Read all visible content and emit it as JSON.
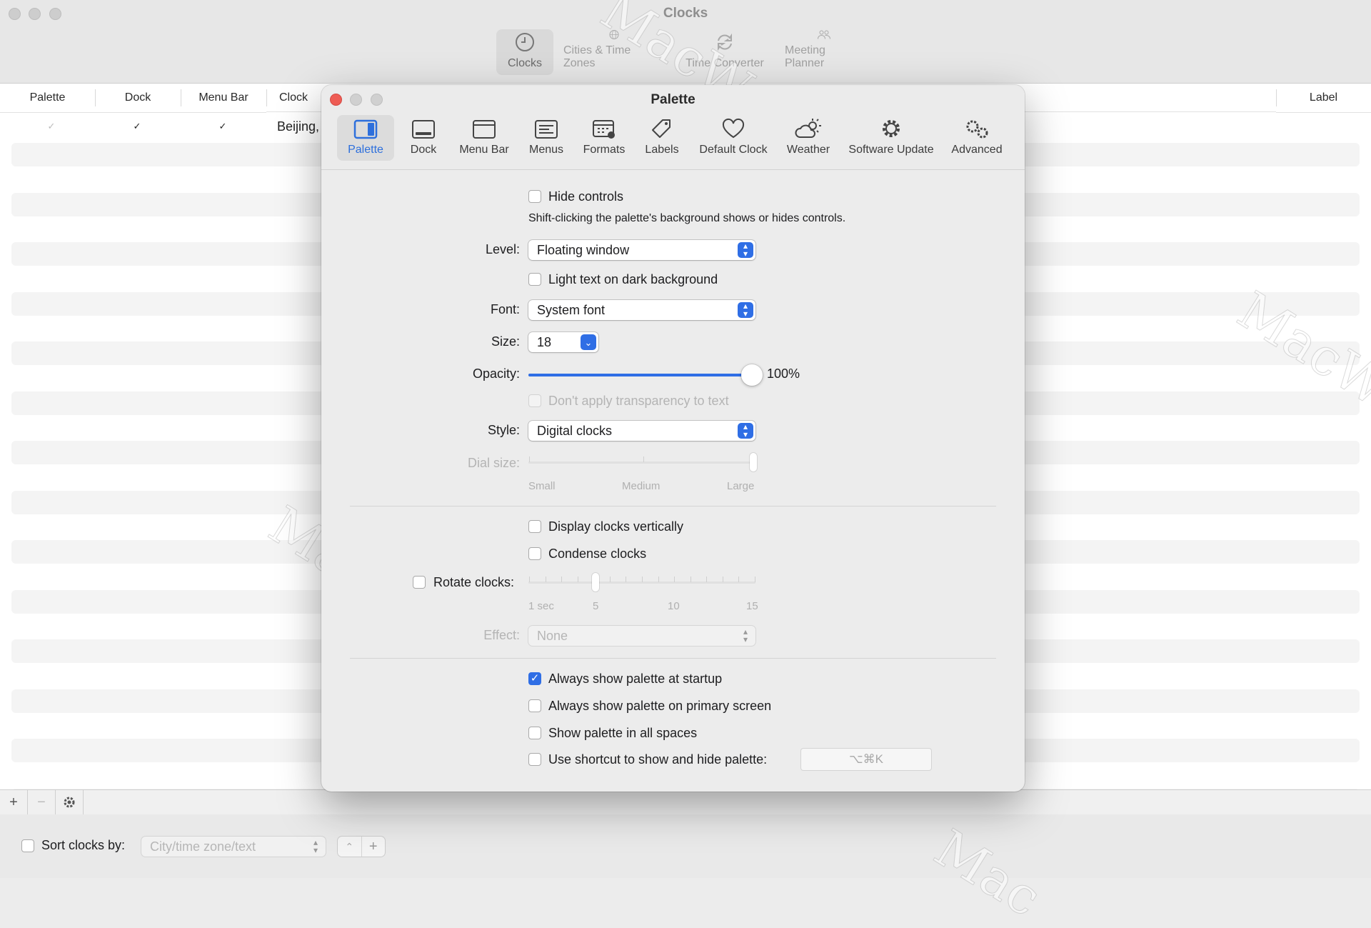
{
  "window": {
    "title": "Clocks",
    "tabs": [
      {
        "label": "Clocks",
        "icon": "clock-icon"
      },
      {
        "label": "Cities & Time Zones",
        "icon": "globe-icon"
      },
      {
        "label": "Time Converter",
        "icon": "sync-icon"
      },
      {
        "label": "Meeting Planner",
        "icon": "people-icon"
      }
    ]
  },
  "list": {
    "columns": [
      "Palette",
      "Dock",
      "Menu Bar",
      "Clock",
      "Label"
    ],
    "rows": [
      {
        "palette": true,
        "dock": true,
        "menubar": true,
        "clock": "Beijing,"
      }
    ]
  },
  "footer": {
    "sort_label": "Sort clocks by:",
    "sort_value": "City/time zone/text"
  },
  "dialog": {
    "title": "Palette",
    "tabs": [
      "Palette",
      "Dock",
      "Menu Bar",
      "Menus",
      "Formats",
      "Labels",
      "Default Clock",
      "Weather",
      "Software Update",
      "Advanced"
    ],
    "hide_controls": "Hide controls",
    "hide_controls_hint": "Shift-clicking the palette's background shows or hides controls.",
    "level_label": "Level:",
    "level_value": "Floating window",
    "light_text": "Light text on dark background",
    "font_label": "Font:",
    "font_value": "System font",
    "size_label": "Size:",
    "size_value": "18",
    "opacity_label": "Opacity:",
    "opacity_value": "100%",
    "opacity_level": 100,
    "no_transparency": "Don't apply transparency to text",
    "style_label": "Style:",
    "style_value": "Digital clocks",
    "dial_label": "Dial size:",
    "dial_ticks": [
      "Small",
      "Medium",
      "Large"
    ],
    "display_vertical": "Display clocks vertically",
    "condense": "Condense clocks",
    "rotate_label": "Rotate clocks:",
    "rotate_ticks": [
      "1 sec",
      "5",
      "10",
      "15"
    ],
    "effect_label": "Effect:",
    "effect_value": "None",
    "always_startup": "Always show palette at startup",
    "always_primary": "Always show palette on primary screen",
    "all_spaces": "Show palette in all spaces",
    "shortcut_label": "Use shortcut to show and hide palette:",
    "shortcut_value": "⌥⌘K"
  },
  "colors": {
    "accent": "#2f6ee5",
    "close": "#ee5c54"
  },
  "watermark": "MacW.com"
}
